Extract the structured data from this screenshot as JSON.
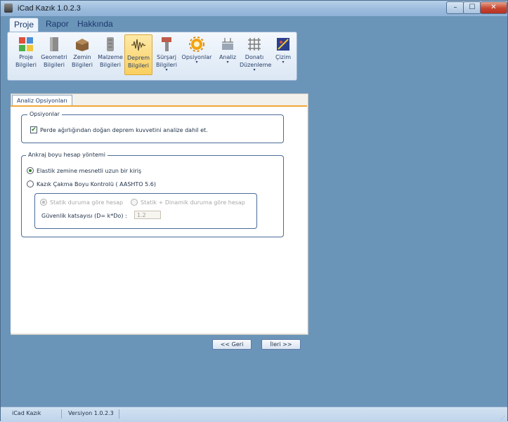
{
  "window": {
    "title": "iCad Kazık 1.0.2.3",
    "controls": {
      "minimize": "–",
      "maximize": "☐",
      "close": "✕"
    }
  },
  "ribbon": {
    "tabs": [
      {
        "label": "Proje",
        "active": true
      },
      {
        "label": "Rapor",
        "active": false
      },
      {
        "label": "Hakkında",
        "active": false
      }
    ],
    "buttons": [
      {
        "line1": "Proje",
        "line2": "Bilgileri",
        "icon": "project-info-icon",
        "caret": false
      },
      {
        "line1": "Geometri",
        "line2": "Bilgileri",
        "icon": "geometry-icon",
        "caret": false
      },
      {
        "line1": "Zemin",
        "line2": "Bilgileri",
        "icon": "soil-icon",
        "caret": false
      },
      {
        "line1": "Malzeme",
        "line2": "Bilgileri",
        "icon": "material-icon",
        "caret": false
      },
      {
        "line1": "Deprem",
        "line2": "Bilgileri",
        "icon": "earthquake-icon",
        "caret": false,
        "active": true
      },
      {
        "line1": "Sürşarj",
        "line2": "Bilgileri",
        "icon": "surcharge-icon",
        "caret": true
      },
      {
        "line1": "Opsiyonlar",
        "line2": "",
        "icon": "options-gear-icon",
        "caret": true
      },
      {
        "line1": "Analiz",
        "line2": "",
        "icon": "analysis-icon",
        "caret": true
      },
      {
        "line1": "Donatı",
        "line2": "Düzenleme",
        "icon": "rebar-icon",
        "caret": true
      },
      {
        "line1": "Çizim",
        "line2": "",
        "icon": "drawing-icon",
        "caret": true
      }
    ],
    "caret": "▾"
  },
  "panel": {
    "tab": "Analiz Opsiyonları",
    "options_group": {
      "legend": "Opsiyonlar",
      "checkbox_label": "Perde ağırlığından doğan deprem kuvvetini analize dahil et.",
      "checked": true
    },
    "anchor_group": {
      "legend": "Ankraj boyu hesap yöntemi",
      "radio1": "Elastik zemine mesnetli uzun bir kiriş",
      "radio2": "Kazık Çakma Boyu Kontrolü ( AASHTO 5.6)",
      "selected": 1,
      "sub": {
        "radio_static": "Statik duruma göre hesap",
        "radio_dynamic": "Statik + Dinamik duruma göre hesap",
        "safety_label": "Güvenlik katsayısı (D= k*Do) :",
        "safety_value": "1.2"
      }
    },
    "back_button": "<< Geri",
    "next_button": "İleri >>"
  },
  "statusbar": {
    "app": "iCad Kazık",
    "version": "Versiyon 1.0.2.3"
  },
  "colors": {
    "background": "#6b94b9",
    "ribbon_active": "#f9cf5f",
    "accent_line": "#f0a73a"
  }
}
